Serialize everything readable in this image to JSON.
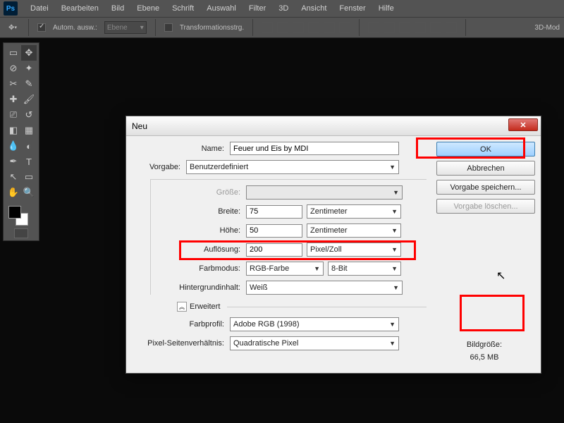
{
  "menu": {
    "items": [
      "Datei",
      "Bearbeiten",
      "Bild",
      "Ebene",
      "Schrift",
      "Auswahl",
      "Filter",
      "3D",
      "Ansicht",
      "Fenster",
      "Hilfe"
    ]
  },
  "options": {
    "autoselect_label": "Autom. ausw.:",
    "autoselect_target": "Ebene",
    "transform_label": "Transformationsstrg.",
    "mode_label": "3D-Mod"
  },
  "dialog": {
    "title": "Neu",
    "name_label": "Name:",
    "name_value": "Feuer und Eis by MDI",
    "preset_label": "Vorgabe:",
    "preset_value": "Benutzerdefiniert",
    "size_label": "Größe:",
    "width_label": "Breite:",
    "width_value": "75",
    "width_unit": "Zentimeter",
    "height_label": "Höhe:",
    "height_value": "50",
    "height_unit": "Zentimeter",
    "resolution_label": "Auflösung:",
    "resolution_value": "200",
    "resolution_unit": "Pixel/Zoll",
    "colormode_label": "Farbmodus:",
    "colormode_value": "RGB-Farbe",
    "bitdepth_value": "8-Bit",
    "bgcontent_label": "Hintergrundinhalt:",
    "bgcontent_value": "Weiß",
    "advanced_label": "Erweitert",
    "profile_label": "Farbprofil:",
    "profile_value": "Adobe RGB (1998)",
    "pixelratio_label": "Pixel-Seitenverhältnis:",
    "pixelratio_value": "Quadratische Pixel"
  },
  "buttons": {
    "ok": "OK",
    "cancel": "Abbrechen",
    "save_preset": "Vorgabe speichern...",
    "delete_preset": "Vorgabe löschen..."
  },
  "image_size": {
    "label": "Bildgröße:",
    "value": "66,5 MB"
  }
}
